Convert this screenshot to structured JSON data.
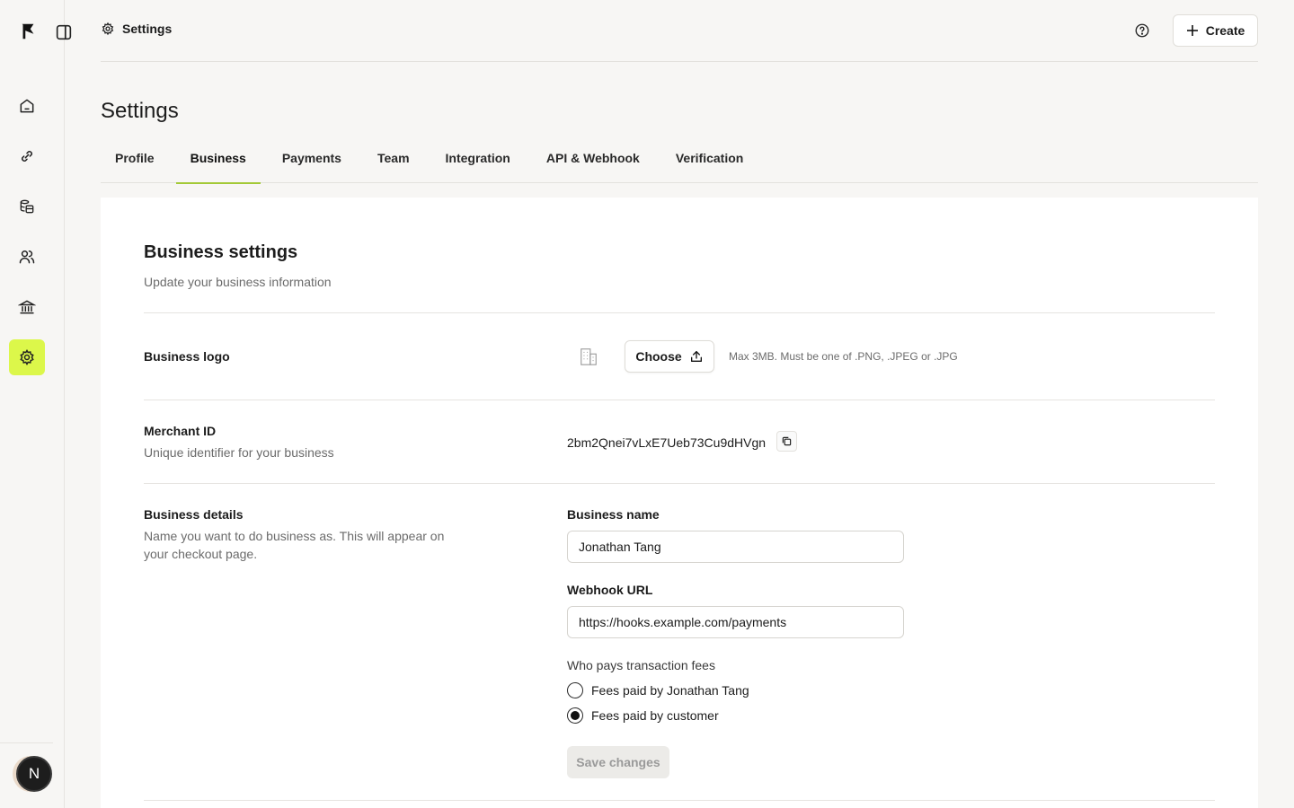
{
  "sidebar": {
    "logo_icon": "flag-logo-icon",
    "toggle_icon": "sidebar-toggle-icon",
    "items": [
      {
        "icon": "home-icon",
        "active": false
      },
      {
        "icon": "link-icon",
        "active": false
      },
      {
        "icon": "coins-icon",
        "active": false
      },
      {
        "icon": "users-icon",
        "active": false
      },
      {
        "icon": "bank-icon",
        "active": false
      },
      {
        "icon": "gear-icon",
        "active": true
      }
    ],
    "avatar_initial": "N",
    "accent_color": "#dcf74a"
  },
  "topbar": {
    "breadcrumb": "Settings",
    "create_label": "Create"
  },
  "page": {
    "title": "Settings",
    "tabs": [
      "Profile",
      "Business",
      "Payments",
      "Team",
      "Integration",
      "API & Webhook",
      "Verification"
    ],
    "active_tab": "Business"
  },
  "business": {
    "title": "Business settings",
    "subtitle": "Update your business information",
    "logo": {
      "label": "Business logo",
      "choose_label": "Choose",
      "hint": "Max 3MB. Must be one of .PNG, .JPEG or .JPG"
    },
    "merchant": {
      "label": "Merchant ID",
      "description": "Unique identifier for your business",
      "value": "2bm2Qnei7vLxE7Ueb73Cu9dHVgn"
    },
    "details": {
      "label": "Business details",
      "description": "Name you want to do business as. This will appear on your checkout page.",
      "name_label": "Business name",
      "name_value": "Jonathan Tang",
      "webhook_label": "Webhook URL",
      "webhook_value": "https://hooks.example.com/payments",
      "fees_label": "Who pays transaction fees",
      "fee_options": [
        {
          "label": "Fees paid by Jonathan Tang",
          "selected": false
        },
        {
          "label": "Fees paid by customer",
          "selected": true
        }
      ],
      "save_label": "Save changes"
    }
  }
}
